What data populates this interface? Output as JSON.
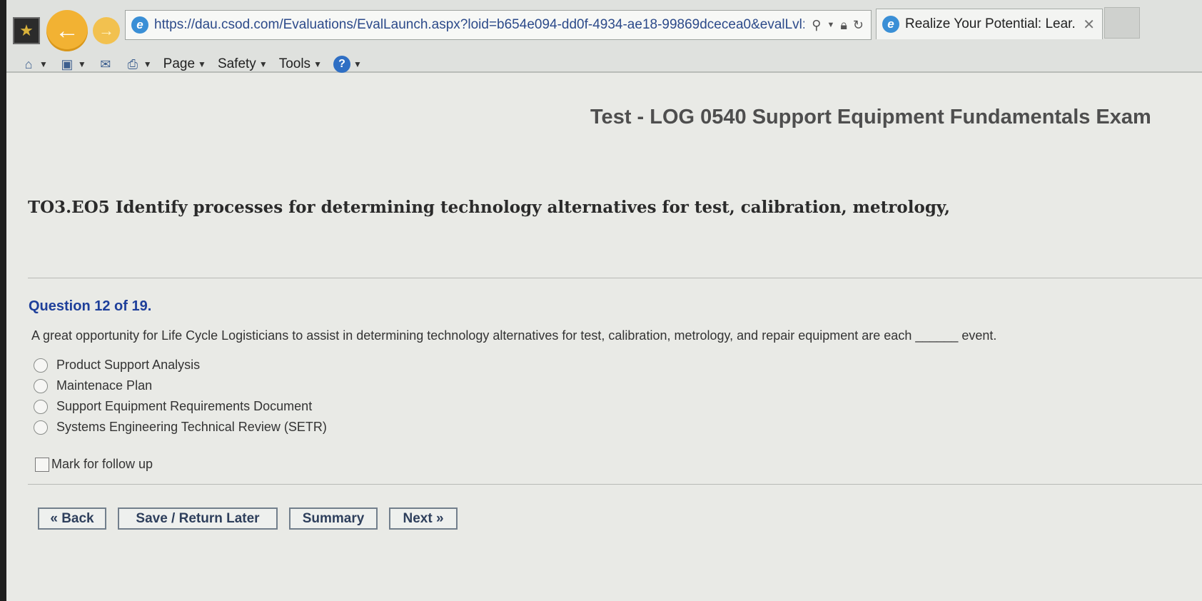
{
  "browser": {
    "address_url": "https://dau.csod.com/Evaluations/EvalLaunch.aspx?loid=b654e094-dd0f-4934-ae18-99869dcecea0&evalLvl:",
    "tab_title": "Realize Your Potential: Lear...",
    "menu": {
      "page_label": "Page",
      "safety_label": "Safety",
      "tools_label": "Tools"
    }
  },
  "exam": {
    "title": "Test - LOG 0540 Support Equipment Fundamentals Exam",
    "objective": "TO3.EO5 Identify processes for determining technology alternatives for test, calibration, metrology,",
    "question_number": "Question 12 of 19.",
    "question_text": "A great opportunity for Life Cycle Logisticians to assist in determining technology alternatives for test, calibration, metrology, and repair equipment are each ______ event.",
    "options": [
      "Product Support Analysis",
      "Maintenace Plan",
      "Support Equipment Requirements Document",
      "Systems Engineering Technical Review (SETR)"
    ],
    "follow_up_label": "Mark for follow up"
  },
  "buttons": {
    "back": "« Back",
    "save": "Save / Return Later",
    "summary": "Summary",
    "next": "Next »"
  },
  "icons": {
    "favorites": "star-icon",
    "back": "arrow-left-icon",
    "forward": "arrow-right-icon",
    "help": "help-icon"
  },
  "colors": {
    "question_number": "#1e3f9a",
    "nav_back": "#f2b233",
    "button_border": "#727f8c"
  }
}
